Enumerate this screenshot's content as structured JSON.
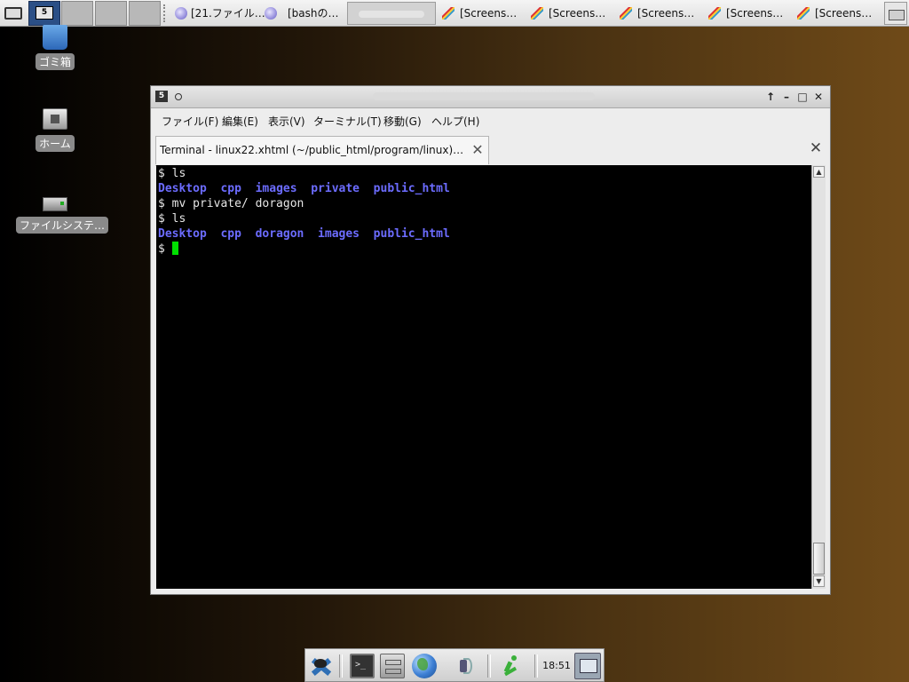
{
  "taskbar": {
    "tasks": [
      {
        "label": "[21.ファイル…",
        "icon": "globe-icon"
      },
      {
        "label": "[bashの…",
        "icon": "globe-icon"
      },
      {
        "label": "[Screens…",
        "icon": "screenshot-icon"
      },
      {
        "label": "[Screens…",
        "icon": "screenshot-icon"
      },
      {
        "label": "[Screens…",
        "icon": "screenshot-icon"
      },
      {
        "label": "[Screens…",
        "icon": "screenshot-icon"
      },
      {
        "label": "[Screens…",
        "icon": "screenshot-icon"
      }
    ],
    "workspace_badge": "5"
  },
  "desktop": {
    "icons": [
      {
        "label": "ゴミ箱",
        "icon": "trash-icon"
      },
      {
        "label": "ホーム",
        "icon": "home-folder-icon"
      },
      {
        "label": "ファイルシステ…",
        "icon": "filesystem-icon"
      }
    ]
  },
  "window": {
    "app_badge": "5",
    "menu": [
      "ファイル(F)",
      "編集(E)",
      "表示(V)",
      "ターミナル(T)",
      "移動(G)",
      "ヘルプ(H)"
    ],
    "tab_title": "Terminal - linux22.xhtml (~/public_html/program/linux)…",
    "terminal": {
      "lines": [
        {
          "kind": "text",
          "text": "$ ls"
        },
        {
          "kind": "dirs",
          "items": [
            "Desktop",
            "cpp",
            "images",
            "private",
            "public_html"
          ]
        },
        {
          "kind": "text",
          "text": "$ mv private/ doragon"
        },
        {
          "kind": "text",
          "text": "$ ls"
        },
        {
          "kind": "dirs",
          "items": [
            "Desktop",
            "cpp",
            "doragon",
            "images",
            "public_html"
          ]
        },
        {
          "kind": "prompt",
          "text": "$ "
        }
      ],
      "colors": {
        "background": "#000000",
        "text": "#e6e6e6",
        "directory": "#6c6cff",
        "cursor": "#00e000"
      }
    }
  },
  "dock": {
    "clock": "18:51"
  }
}
